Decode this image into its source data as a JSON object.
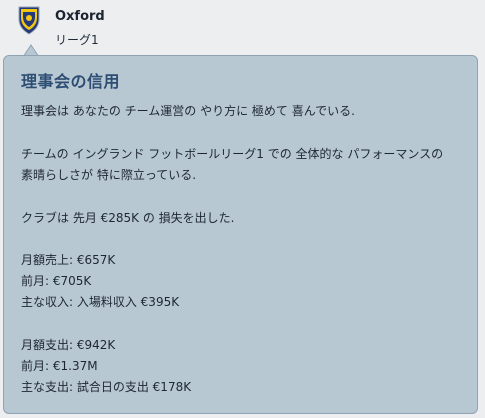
{
  "team": {
    "name": "Oxford",
    "league": "リーグ1"
  },
  "panel": {
    "title": "理事会の信用",
    "lines": [
      "理事会は あなたの チーム運営の やり方に 極めて 喜んでいる.",
      "チームの イングランド フットボールリーグ1 での 全体的な パフォーマンスの",
      "素晴らしさが 特に際立っている.",
      "クラブは 先月 €285K の 損失を出した.",
      "月額売上: €657K",
      "前月: €705K",
      "主な収入: 入場料収入 €395K",
      "月額支出: €942K",
      "前月: €1.37M",
      "主な支出: 試合日の支出 €178K"
    ]
  },
  "colors": {
    "panel_bg": "#b8c8d3",
    "title": "#2d4d73",
    "crest_blue": "#233a7a",
    "crest_yellow": "#f2c611"
  }
}
